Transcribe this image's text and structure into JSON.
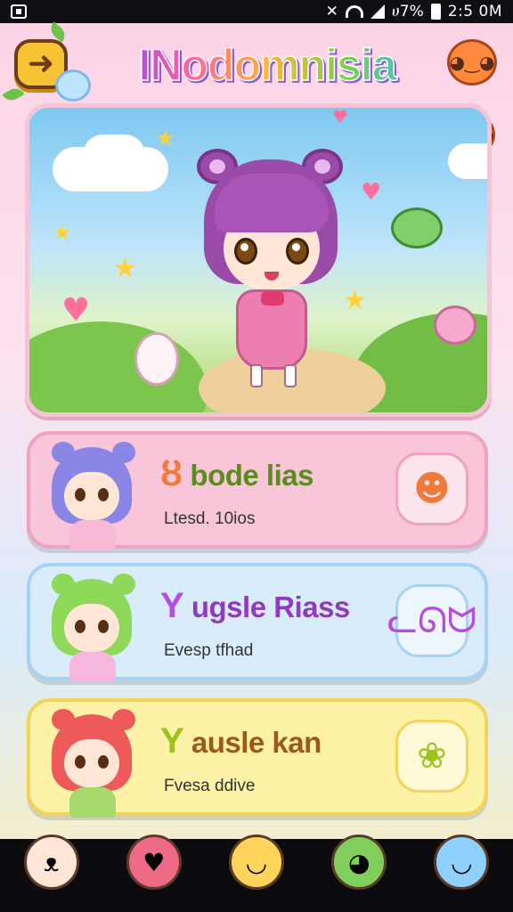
{
  "status_bar": {
    "time": "2:5 0M",
    "battery_text": "ሀ7%",
    "icons": [
      "sim-icon",
      "mute-icon",
      "wifi-icon",
      "signal-icon",
      "battery-icon"
    ]
  },
  "header": {
    "title": "INodomnisia",
    "back_icon": "back-arrow-icon",
    "back_glyph": "➜"
  },
  "hero": {
    "scene": "character-showcase",
    "accent": "#f6c4d7"
  },
  "cards": [
    {
      "name": "bode lias",
      "prefix_glyph": "ȣ",
      "subtitle": "Ltesd. 10ios",
      "icon": "smiley-face-icon",
      "icon_glyph": "☻",
      "bg": "#f9c5d8",
      "border": "#f0a3c0",
      "name_color": "#5a8c1e",
      "prefix_color": "#f07a3a",
      "hair_color": "#8a86e6",
      "body_color": "#f9b9d6"
    },
    {
      "name": "ugsle Riass",
      "prefix_glyph": "Y",
      "subtitle": "Evesp tfhad",
      "icon": "cat-icon",
      "icon_glyph": "ᓚᘏᗢ",
      "bg": "#d9ecfb",
      "border": "#a8d2f2",
      "name_color": "#8f3bbf",
      "prefix_color": "#b54ee0",
      "hair_color": "#8ed85a",
      "body_color": "#f5b7dd"
    },
    {
      "name": "ausle kan",
      "prefix_glyph": "Y",
      "subtitle": "Fvesa ddive",
      "icon": "flower-bud-icon",
      "icon_glyph": "❀",
      "bg": "#fdf2a6",
      "border": "#f2d45a",
      "name_color": "#9b5a1a",
      "prefix_color": "#9bc21e",
      "hair_color": "#ee5a5a",
      "body_color": "#a7d96c"
    }
  ],
  "bottom_nav": [
    {
      "icon": "bear-face-icon",
      "glyph": "ᴥ",
      "color": "#ffe6d6"
    },
    {
      "icon": "pink-book-icon",
      "glyph": "♥",
      "color": "#ee6a86"
    },
    {
      "icon": "yellow-blob-icon",
      "glyph": "◡",
      "color": "#ffd45a"
    },
    {
      "icon": "frog-icon",
      "glyph": "◕",
      "color": "#7fcf5a"
    },
    {
      "icon": "blue-blob-icon",
      "glyph": "◡",
      "color": "#8fd0ff"
    }
  ]
}
